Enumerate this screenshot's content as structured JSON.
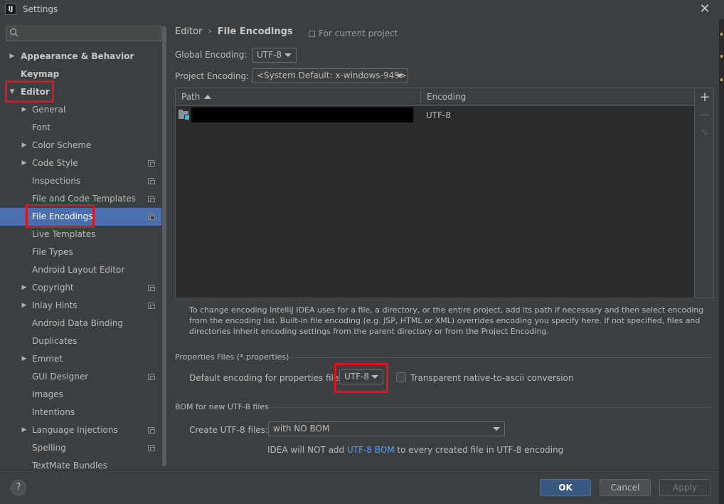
{
  "window": {
    "title": "Settings",
    "app_icon": "IJ"
  },
  "search": {
    "placeholder": "",
    "value": ""
  },
  "sidebar": {
    "items": [
      {
        "label": "Appearance & Behavior",
        "arrow": "▶"
      },
      {
        "label": "Keymap",
        "arrow": ""
      },
      {
        "label": "Editor",
        "arrow": "▼"
      },
      {
        "label": "General",
        "arrow": "▶"
      },
      {
        "label": "Font",
        "arrow": ""
      },
      {
        "label": "Color Scheme",
        "arrow": "▶"
      },
      {
        "label": "Code Style",
        "arrow": "▶"
      },
      {
        "label": "Inspections",
        "arrow": ""
      },
      {
        "label": "File and Code Templates",
        "arrow": ""
      },
      {
        "label": "File Encodings",
        "arrow": ""
      },
      {
        "label": "Live Templates",
        "arrow": ""
      },
      {
        "label": "File Types",
        "arrow": ""
      },
      {
        "label": "Android Layout Editor",
        "arrow": ""
      },
      {
        "label": "Copyright",
        "arrow": "▶"
      },
      {
        "label": "Inlay Hints",
        "arrow": "▶"
      },
      {
        "label": "Android Data Binding",
        "arrow": ""
      },
      {
        "label": "Duplicates",
        "arrow": ""
      },
      {
        "label": "Emmet",
        "arrow": "▶"
      },
      {
        "label": "GUI Designer",
        "arrow": ""
      },
      {
        "label": "Images",
        "arrow": ""
      },
      {
        "label": "Intentions",
        "arrow": ""
      },
      {
        "label": "Language Injections",
        "arrow": "▶"
      },
      {
        "label": "Spelling",
        "arrow": ""
      },
      {
        "label": "TextMate Bundles",
        "arrow": ""
      }
    ],
    "selected": "File Encodings"
  },
  "breadcrumb": {
    "parent": "Editor",
    "separator": "›",
    "current": "File Encodings"
  },
  "scope_note": "For current project",
  "global_encoding": {
    "label": "Global Encoding:",
    "value": "UTF-8"
  },
  "project_encoding": {
    "label": "Project Encoding:",
    "value": "<System Default: x-windows-949>"
  },
  "table": {
    "columns": [
      "Path",
      "Encoding"
    ],
    "rows": [
      {
        "path": "",
        "encoding": "UTF-8"
      }
    ]
  },
  "toolbar": {
    "add": "+",
    "remove": "−",
    "edit": "✎"
  },
  "help_text": "To change encoding IntelliJ IDEA uses for a file, a directory, or the entire project, add its path if necessary and then select encoding from the encoding list. Built-in file encoding (e.g. JSP, HTML or XML) overrides encoding you specify here. If not specified, files and directories inherit encoding settings from the parent directory or from the Project Encoding.",
  "properties": {
    "group_title": "Properties Files (*.properties)",
    "default_label": "Default encoding for properties files:",
    "default_value": "UTF-8",
    "transparent_label": "Transparent native-to-ascii conversion",
    "transparent_checked": false
  },
  "bom": {
    "group_title": "BOM for new UTF-8 files",
    "create_label": "Create UTF-8 files:",
    "create_value": "with NO BOM",
    "note_prefix": "IDEA will NOT add ",
    "note_link": "UTF-8 BOM",
    "note_suffix": " to every created file in UTF-8 encoding"
  },
  "footer": {
    "help": "?",
    "ok": "OK",
    "cancel": "Cancel",
    "apply": "Apply"
  },
  "colors": {
    "selection": "#4b6eaf",
    "highlight_box": "#e0141e",
    "link": "#589df6",
    "primary_button": "#365880"
  }
}
